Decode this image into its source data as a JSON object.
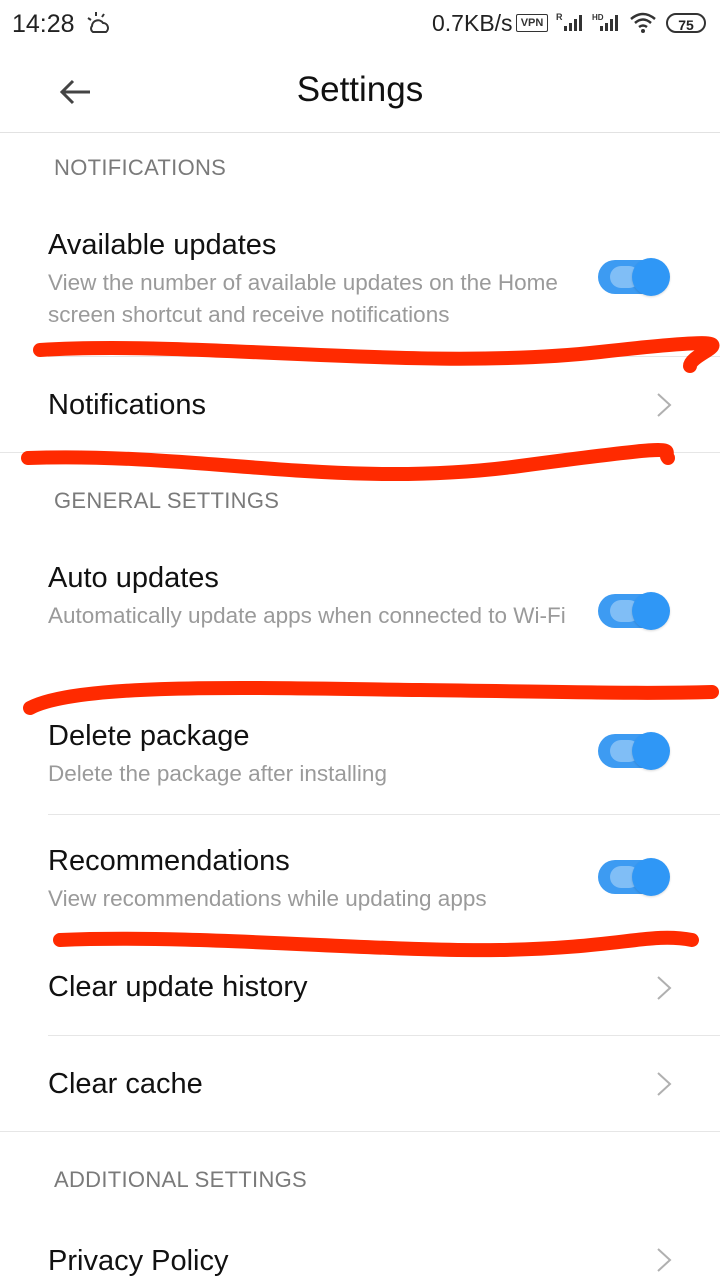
{
  "status_bar": {
    "time": "14:28",
    "net_speed": "0.7KB/s",
    "vpn": "VPN",
    "signal1_label": "R",
    "signal2_label": "HD",
    "battery": "75"
  },
  "header": {
    "title": "Settings",
    "back_icon": "arrow-left-icon"
  },
  "sections": {
    "notifications": "NOTIFICATIONS",
    "general": "GENERAL SETTINGS",
    "additional": "ADDITIONAL SETTINGS"
  },
  "items": {
    "available_updates": {
      "title": "Available updates",
      "subtitle": "View the number of available updates on the Home screen shortcut and receive notifications",
      "enabled": true
    },
    "notifications": {
      "title": "Notifications"
    },
    "auto_updates": {
      "title": "Auto updates",
      "subtitle": "Automatically update apps when connected to Wi-Fi",
      "enabled": true
    },
    "delete_package": {
      "title": "Delete package",
      "subtitle": "Delete the package after installing",
      "enabled": true
    },
    "recommendations": {
      "title": "Recommendations",
      "subtitle": "View recommendations while updating apps",
      "enabled": true
    },
    "clear_update_history": {
      "title": "Clear update history"
    },
    "clear_cache": {
      "title": "Clear cache"
    },
    "privacy_policy": {
      "title": "Privacy Policy"
    }
  },
  "colors": {
    "accent": "#2f97f6",
    "annotation": "#ff2a00",
    "section_text": "#7a7a7a",
    "subtitle_text": "#9a9a9a"
  }
}
